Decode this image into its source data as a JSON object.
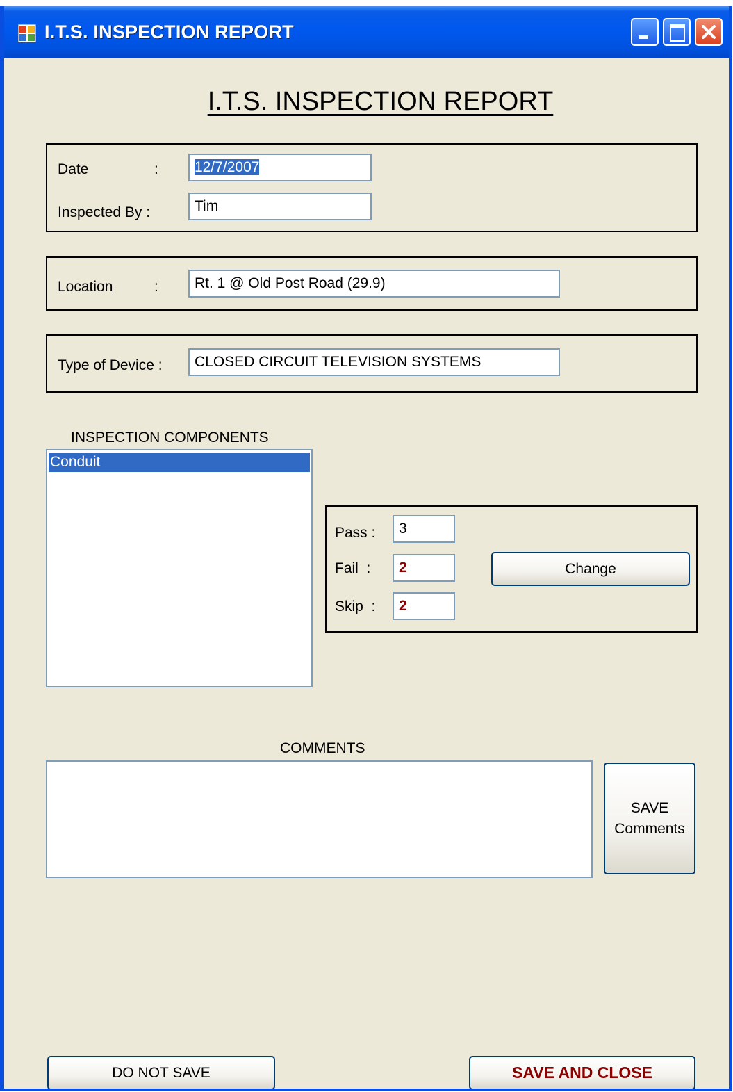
{
  "window": {
    "title": "I.T.S. INSPECTION REPORT",
    "controls": {
      "minimize_icon": "minimize-icon",
      "maximize_icon": "maximize-icon",
      "close_icon": "close-icon"
    },
    "colors": {
      "titlebar": "#0058ee",
      "client_background": "#ece9d8",
      "selection": "#316ac5",
      "count_value": "#8b0000"
    }
  },
  "heading": "I.T.S. INSPECTION REPORT",
  "header_group": {
    "date_label": "Date",
    "date_colon": ":",
    "date_value": "12/7/2007",
    "inspected_by_label": "Inspected By :",
    "inspected_by_value": "Tim"
  },
  "location_group": {
    "label": "Location",
    "colon": ":",
    "value": "Rt. 1 @ Old Post Road (29.9)"
  },
  "device_group": {
    "label": "Type of Device :",
    "value": "CLOSED CIRCUIT TELEVISION SYSTEMS"
  },
  "components": {
    "label": "INSPECTION COMPONENTS",
    "items": [
      "Conduit"
    ],
    "selected_index": 0
  },
  "results": {
    "pass_label": "Pass :",
    "pass_value": "3",
    "fail_label": "Fail  :",
    "fail_value": "2",
    "skip_label": "Skip  :",
    "skip_value": "2",
    "change_button": "Change"
  },
  "comments": {
    "label": "COMMENTS",
    "value": "",
    "save_button_line1": "SAVE",
    "save_button_line2": "Comments"
  },
  "footer": {
    "do_not_save_button": "DO NOT SAVE",
    "save_and_close_button": "SAVE AND CLOSE"
  }
}
